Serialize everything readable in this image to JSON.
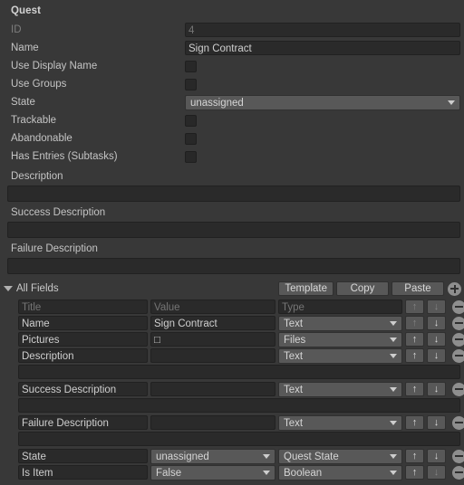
{
  "inspector": {
    "section_title": "Quest",
    "properties": [
      {
        "label": "ID",
        "type": "text",
        "value": "4",
        "disabled": true
      },
      {
        "label": "Name",
        "type": "text",
        "value": "Sign Contract",
        "disabled": false
      },
      {
        "label": "Use Display Name",
        "type": "checkbox",
        "checked": false
      },
      {
        "label": "Use Groups",
        "type": "checkbox",
        "checked": false
      },
      {
        "label": "State",
        "type": "popup",
        "value": "unassigned"
      },
      {
        "label": "Trackable",
        "type": "checkbox",
        "checked": false
      },
      {
        "label": "Abandonable",
        "type": "checkbox",
        "checked": false
      },
      {
        "label": "Has Entries (Subtasks)",
        "type": "checkbox",
        "checked": false
      }
    ],
    "descriptions": [
      {
        "label": "Description",
        "value": ""
      },
      {
        "label": "Success Description",
        "value": ""
      },
      {
        "label": "Failure Description",
        "value": ""
      }
    ]
  },
  "all_fields": {
    "foldout_label": "All Fields",
    "expanded": true,
    "buttons": [
      {
        "label": "Template",
        "name": "template-button"
      },
      {
        "label": "Copy",
        "name": "copy-button"
      },
      {
        "label": "Paste",
        "name": "paste-button"
      }
    ],
    "add_icon": "plus-circle-icon",
    "remove_icon": "minus-circle-icon",
    "move_up_icon": "arrow-up-icon",
    "move_down_icon": "arrow-down-icon",
    "arrow_up_glyph": "↑",
    "arrow_down_glyph": "↓",
    "header": {
      "title": "Title",
      "value": "Value",
      "type": "Type"
    },
    "rows": [
      {
        "title": "Name",
        "value": "Sign Contract",
        "value_kind": "text",
        "type": "Text",
        "up_enabled": false,
        "down_enabled": true,
        "subrow": false
      },
      {
        "title": "Pictures",
        "value": "□",
        "value_kind": "text",
        "type": "Files",
        "up_enabled": true,
        "down_enabled": true,
        "subrow": false
      },
      {
        "title": "Description",
        "value": "",
        "value_kind": "text",
        "type": "Text",
        "up_enabled": true,
        "down_enabled": true,
        "subrow": true
      },
      {
        "title": "Success Description",
        "value": "",
        "value_kind": "text",
        "type": "Text",
        "up_enabled": true,
        "down_enabled": true,
        "subrow": true
      },
      {
        "title": "Failure Description",
        "value": "",
        "value_kind": "text",
        "type": "Text",
        "up_enabled": true,
        "down_enabled": true,
        "subrow": true
      },
      {
        "title": "State",
        "value": "unassigned",
        "value_kind": "popup",
        "type": "Quest State",
        "up_enabled": true,
        "down_enabled": true,
        "subrow": false
      },
      {
        "title": "Is Item",
        "value": "False",
        "value_kind": "popup",
        "type": "Boolean",
        "up_enabled": true,
        "down_enabled": false,
        "subrow": false
      }
    ]
  },
  "colors": {
    "window_bg": "#383838",
    "field_bg": "#2a2a2a",
    "popup_bg": "#585858",
    "text": "#c4c4c4",
    "text_dim": "#7d7d7d",
    "circle_btn": "#8e8e8e"
  }
}
